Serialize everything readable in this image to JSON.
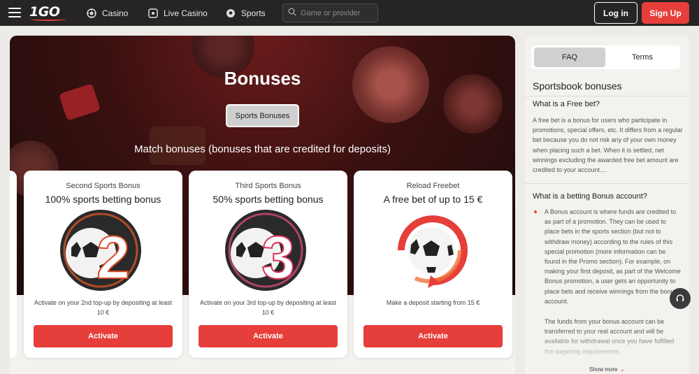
{
  "header": {
    "brand": "1GO",
    "nav": [
      {
        "label": "Casino",
        "icon": "casino-chip-icon"
      },
      {
        "label": "Live Casino",
        "icon": "live-casino-icon"
      },
      {
        "label": "Sports",
        "icon": "soccer-ball-icon"
      }
    ],
    "search": {
      "placeholder": "Game or provider"
    },
    "login_label": "Log in",
    "signup_label": "Sign Up"
  },
  "hero": {
    "title": "Bonuses",
    "active_tab": "Sports Bonuses",
    "subheading": "Match bonuses (bonuses that are credited for deposits)"
  },
  "cards": [
    {
      "label": "Second Sports Bonus",
      "title": "100% sports betting bonus",
      "badge": "2",
      "description": "Activate on your 2nd top-up by depositing at least 10 €",
      "button": "Activate"
    },
    {
      "label": "Third Sports Bonus",
      "title": "50% sports betting bonus",
      "badge": "3",
      "description": "Activate on your 3rd top-up by depositing at least 10 €",
      "button": "Activate"
    },
    {
      "label": "Reload Freebet",
      "title": "A free bet of up to 15 €",
      "badge": "",
      "description": "Make a deposit starting from 15 €",
      "button": "Activate"
    }
  ],
  "faq": {
    "tabs": [
      "FAQ",
      "Terms"
    ],
    "active_tab": "FAQ",
    "heading": "Sportsbook bonuses",
    "q1": "What is a Free bet?",
    "a1": "A free bet is a bonus for users who participate in promotions, special offers, etc. It differs from a regular bet because you do not risk any of your own money when placing such a bet. When it is settled, net winnings excluding the awarded free bet amount are credited to your account....",
    "q2": "What is a betting Bonus account?",
    "a2_bullet": "A Bonus account is where funds are credited to as part of a promotion. They can be used to place bets in the sports section (but not to withdraw money) according to the rules of this special promotion (more information can be found in the Promo section). For example, on making your first deposit, as part of the Welcome Bonus promotion, a user gets an opportunity to place bets and receive winnings from the bonus account.",
    "a2_more": "The funds from your bonus account can be transferred to your real account and will be available for withdrawal once you have fulfilled the wagering requirements.",
    "show_more": "Show more"
  },
  "colors": {
    "accent": "#e63e3a",
    "topbar": "#262424",
    "hero_dark": "#1c0b0b"
  }
}
